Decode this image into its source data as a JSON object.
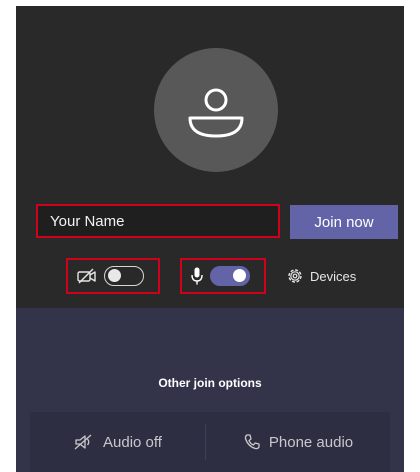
{
  "join": {
    "name_value": "Your Name",
    "join_label": "Join now",
    "accent_color": "#6264a7",
    "highlight_color": "#d0021b"
  },
  "camera": {
    "icon": "camera-off-icon",
    "toggle_state": "off"
  },
  "microphone": {
    "icon": "microphone-icon",
    "toggle_state": "on"
  },
  "devices": {
    "icon": "gear-icon",
    "label": "Devices"
  },
  "other_options": {
    "title": "Other join options",
    "items": [
      {
        "icon": "speaker-off-icon",
        "label": "Audio off"
      },
      {
        "icon": "phone-icon",
        "label": "Phone audio"
      }
    ]
  }
}
